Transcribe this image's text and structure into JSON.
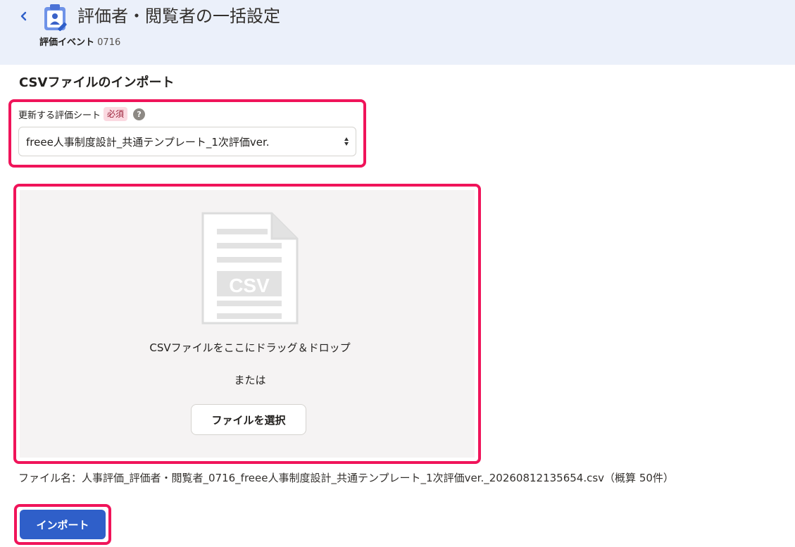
{
  "header": {
    "title": "評価者・閲覧者の一括設定",
    "event_label": "評価イベント",
    "event_value": "0716"
  },
  "section": {
    "title": "CSVファイルのインポート"
  },
  "sheet_field": {
    "label": "更新する評価シート",
    "required_badge": "必須",
    "help_icon_text": "?",
    "selected_value": "freee人事制度設計_共通テンプレート_1次評価ver."
  },
  "dropzone": {
    "icon_text": "CSV",
    "instruction": "CSVファイルをここにドラッグ＆ドロップ",
    "or_text": "または",
    "choose_button": "ファイルを選択"
  },
  "file_info": {
    "text": "ファイル名：人事評価_評価者・閲覧者_0716_freee人事制度設計_共通テンプレート_1次評価ver._20260812135654.csv（概算 50件）"
  },
  "actions": {
    "import_button": "インポート"
  },
  "colors": {
    "header_bg": "#ebf0fa",
    "primary": "#2f5fc9",
    "highlight": "#f0145a",
    "dropzone_bg": "#f5f3f3",
    "required_badge_bg": "#fbd9e1"
  },
  "icons": {
    "back": "chevron-left-icon",
    "app": "clipboard-user-icon",
    "help": "question-circle-icon",
    "file": "csv-file-icon",
    "select": "select-arrows-icon"
  }
}
